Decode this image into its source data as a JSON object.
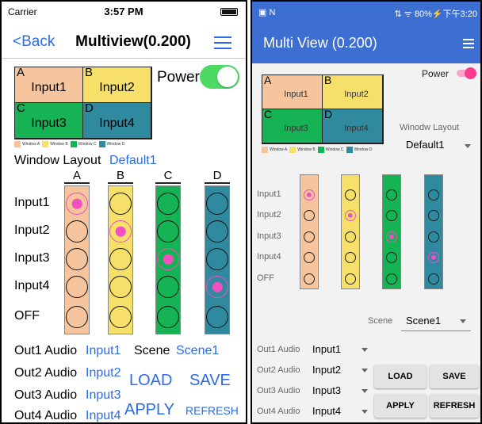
{
  "colors": {
    "window_a": "#f6c49d",
    "window_b": "#f6e06a",
    "window_c": "#16b354",
    "window_d": "#2f8aa0",
    "ios_blue": "#2b6be6",
    "android_bar": "#3d6fd3",
    "selected": "#f050c0"
  },
  "ios": {
    "status": {
      "carrier": "Carrier",
      "time": "3:57 PM"
    },
    "nav": {
      "back": "<Back",
      "title": "Multiview(0.200)"
    },
    "layout": {
      "cells": [
        {
          "letter": "A",
          "name": "Input1"
        },
        {
          "letter": "B",
          "name": "Input2"
        },
        {
          "letter": "C",
          "name": "Input3"
        },
        {
          "letter": "D",
          "name": "Input4"
        }
      ],
      "legend": [
        "Window A",
        "Window B",
        "Window C",
        "Window D"
      ]
    },
    "power_label": "Power",
    "power_on": true,
    "window_layout_label": "Window Layout",
    "window_layout_value": "Default1",
    "matrix": {
      "columns": [
        "A",
        "B",
        "C",
        "D"
      ],
      "rows": [
        "Input1",
        "Input2",
        "Input3",
        "Input4",
        "OFF"
      ],
      "selected_row_per_column": [
        0,
        1,
        2,
        3
      ]
    },
    "audio": [
      {
        "label": "Out1 Audio",
        "value": "Input1"
      },
      {
        "label": "Out2 Audio",
        "value": "Input2"
      },
      {
        "label": "Out3 Audio",
        "value": "Input3"
      },
      {
        "label": "Out4 Audio",
        "value": "Input4"
      }
    ],
    "scene_label": "Scene",
    "scene_value": "Scene1",
    "buttons": {
      "load": "LOAD",
      "save": "SAVE",
      "apply": "APPLY",
      "refresh": "REFRESH"
    }
  },
  "android": {
    "status": {
      "left": "▣ N",
      "right": "⇅ ᯤ 80%⚡下午3:20"
    },
    "title": "Multi View (0.200)",
    "layout": {
      "cells": [
        {
          "letter": "A",
          "name": "Input1"
        },
        {
          "letter": "B",
          "name": "Input2"
        },
        {
          "letter": "C",
          "name": "Input3"
        },
        {
          "letter": "D",
          "name": "Input4"
        }
      ],
      "legend": [
        "Window A",
        "Window B",
        "Window C",
        "Window D"
      ]
    },
    "power_label": "Power",
    "power_on": true,
    "window_layout_label": "Winodw Layout",
    "window_layout_value": "Default1",
    "matrix": {
      "columns": [
        "A",
        "B",
        "C",
        "D"
      ],
      "rows": [
        "Input1",
        "Input2",
        "Input3",
        "Input4",
        "OFF"
      ],
      "selected_row_per_column": [
        0,
        1,
        2,
        3
      ]
    },
    "scene_label": "Scene",
    "scene_value": "Scene1",
    "audio": [
      {
        "label": "Out1 Audio",
        "value": "Input1"
      },
      {
        "label": "Out2 Audio",
        "value": "Input2"
      },
      {
        "label": "Out3 Audio",
        "value": "Input3"
      },
      {
        "label": "Out4 Audio",
        "value": "Input4"
      }
    ],
    "buttons": {
      "load": "LOAD",
      "save": "SAVE",
      "apply": "APPLY",
      "refresh": "REFRESH"
    }
  }
}
